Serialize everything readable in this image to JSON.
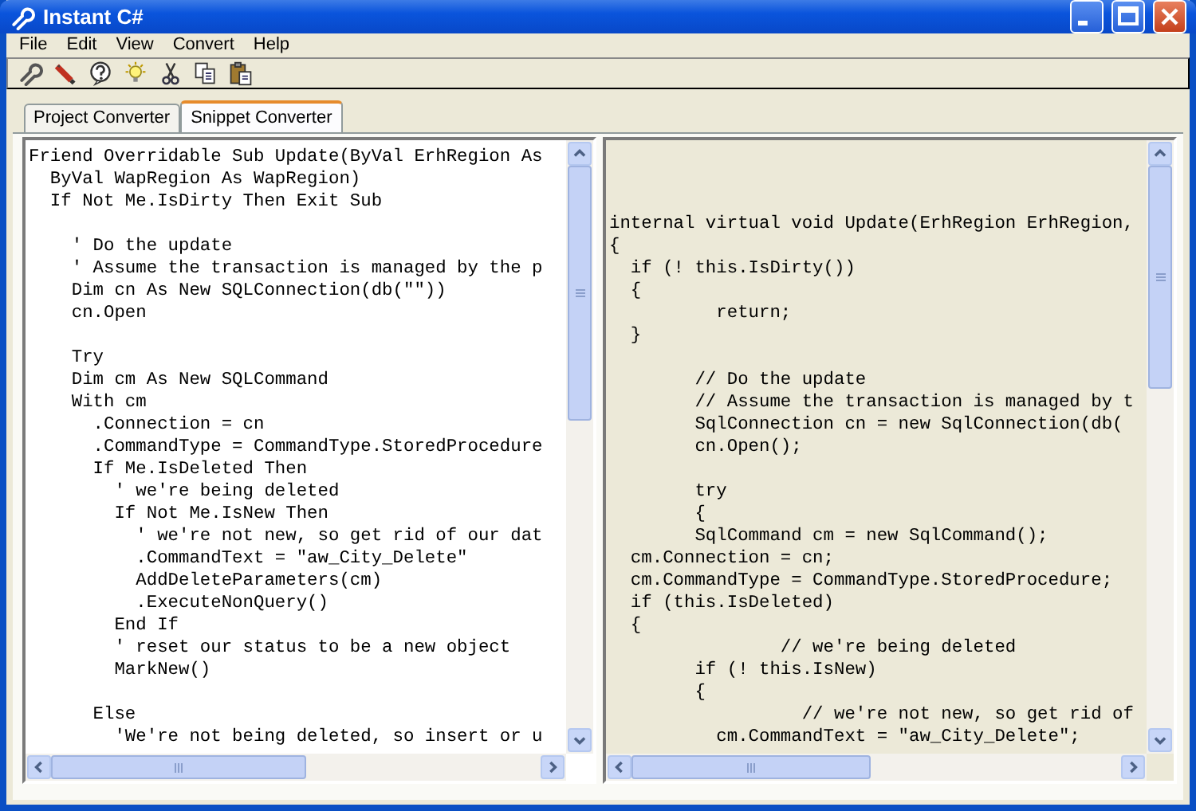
{
  "window": {
    "title": "Instant C#"
  },
  "menu": [
    "File",
    "Edit",
    "View",
    "Convert",
    "Help"
  ],
  "tabs": [
    {
      "label": "Project Converter",
      "selected": false
    },
    {
      "label": "Snippet Converter",
      "selected": true
    }
  ],
  "panes": [
    {
      "kind": "source",
      "code": "Friend Overridable Sub Update(ByVal ErhRegion As\n  ByVal WapRegion As WapRegion)\n  If Not Me.IsDirty Then Exit Sub\n\n    ' Do the update\n    ' Assume the transaction is managed by the p\n    Dim cn As New SQLConnection(db(\"\"))\n    cn.Open\n\n    Try\n    Dim cm As New SQLCommand\n    With cm\n      .Connection = cn\n      .CommandType = CommandType.StoredProcedure\n      If Me.IsDeleted Then\n        ' we're being deleted\n        If Not Me.IsNew Then\n          ' we're not new, so get rid of our dat\n          .CommandText = \"aw_City_Delete\"\n          AddDeleteParameters(cm)\n          .ExecuteNonQuery()\n        End If\n        ' reset our status to be a new object\n        MarkNew()\n\n      Else\n        'We're not being deleted, so insert or u"
    },
    {
      "kind": "result",
      "code": "\n\n\ninternal virtual void Update(ErhRegion ErhRegion,\n{\n  if (! this.IsDirty())\n  {\n          return;\n  }\n\n        // Do the update\n        // Assume the transaction is managed by t\n        SqlConnection cn = new SqlConnection(db(\n        cn.Open();\n\n        try\n        {\n        SqlCommand cm = new SqlCommand();\n  cm.Connection = cn;\n  cm.CommandType = CommandType.StoredProcedure;\n  if (this.IsDeleted)\n  {\n                // we're being deleted\n        if (! this.IsNew)\n        {\n                  // we're not new, so get rid of\n          cm.CommandText = \"aw_City_Delete\";"
    }
  ]
}
